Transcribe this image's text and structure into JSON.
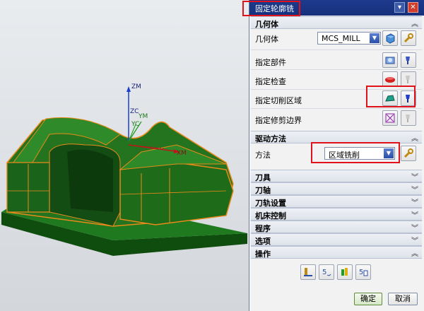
{
  "dialog": {
    "title": "固定轮廓铣",
    "sections": {
      "geometry": {
        "header": "几何体",
        "rows": [
          {
            "label": "几何体",
            "value": "MCS_MILL"
          },
          {
            "label": "指定部件"
          },
          {
            "label": "指定检查"
          },
          {
            "label": "指定切削区域"
          },
          {
            "label": "指定修剪边界"
          }
        ]
      },
      "drive": {
        "header": "驱动方法",
        "method_label": "方法",
        "method_value": "区域铣削"
      },
      "collapsed": [
        "刀具",
        "刀轴",
        "刀轨设置",
        "机床控制",
        "程序",
        "选项"
      ],
      "ops": {
        "header": "操作"
      }
    },
    "ok_label": "确定",
    "cancel_label": "取消"
  },
  "viewport": {
    "axes": {
      "zm": "ZM",
      "zc": "ZC",
      "ym": "YM",
      "yc": "YC",
      "xm": "XM"
    }
  },
  "colors": {
    "highlight": "#e0121b",
    "model_green": "#1f6a1f",
    "edge_orange": "#e88a1a",
    "titlebar": "#1e3a8c"
  }
}
